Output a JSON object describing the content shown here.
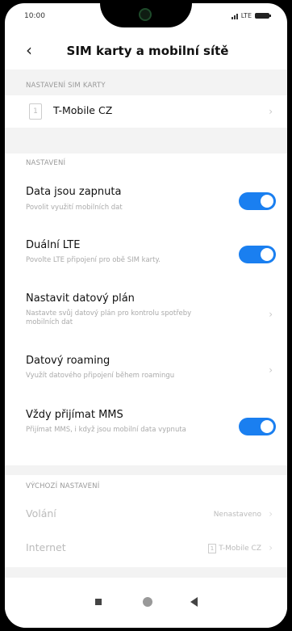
{
  "status_bar": {
    "time": "10:00",
    "network": "LTE"
  },
  "header": {
    "title": "SIM karty a mobilní sítě"
  },
  "sim_section": {
    "heading": "NASTAVENÍ SIM KARTY",
    "sim_slot": "1",
    "sim_name": "T-Mobile CZ"
  },
  "settings_section": {
    "heading": "NASTAVENÍ",
    "items": [
      {
        "label": "Data jsou zapnuta",
        "description": "Povolit využití mobilních dat",
        "control": "toggle",
        "on": true
      },
      {
        "label": "Duální LTE",
        "description": "Povolte LTE připojení pro obě SIM karty.",
        "control": "toggle",
        "on": true
      },
      {
        "label": "Nastavit datový plán",
        "description": "Nastavte svůj datový plán pro kontrolu spotřeby mobilních dat",
        "control": "chevron"
      },
      {
        "label": "Datový roaming",
        "description": "Využít datového připojení během roamingu",
        "control": "chevron"
      },
      {
        "label": "Vždy přijímat MMS",
        "description": "Přijímat MMS, i když jsou mobilní data vypnuta",
        "control": "toggle",
        "on": true
      }
    ]
  },
  "default_section": {
    "heading": "VÝCHOZÍ NASTAVENÍ",
    "calls_label": "Volání",
    "calls_value": "Nenastaveno",
    "internet_label": "Internet",
    "internet_sim_slot": "1",
    "internet_value": "T-Mobile CZ"
  },
  "icons": [
    "back-arrow-icon",
    "chevron-right-icon",
    "sim-card-icon",
    "recents-square-icon",
    "home-circle-icon",
    "back-triangle-icon"
  ],
  "colors": {
    "toggle_on": "#1a7ff0",
    "section_background": "#f3f3f3"
  }
}
